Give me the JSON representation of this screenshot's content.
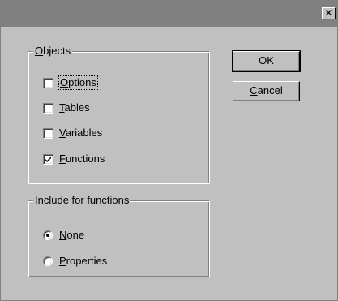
{
  "window": {
    "close_glyph": "✕"
  },
  "objects": {
    "legend": "Objects",
    "legend_mnemonic": "O",
    "legend_rest": "bjects",
    "items": [
      {
        "first": "O",
        "rest": "ptions",
        "checked": false
      },
      {
        "first": "T",
        "rest": "ables",
        "checked": false
      },
      {
        "first": "V",
        "rest": "ariables",
        "checked": false
      },
      {
        "first": "F",
        "rest": "unctions",
        "checked": true
      }
    ]
  },
  "include": {
    "legend": "Include for functions",
    "items": [
      {
        "first": "N",
        "rest": "one",
        "selected": true
      },
      {
        "first": "P",
        "rest": "roperties",
        "selected": false
      }
    ]
  },
  "buttons": {
    "ok": "OK",
    "cancel_first": "C",
    "cancel_rest": "ancel"
  },
  "colors": {
    "face": "#c0c0c0",
    "titlebar": "#808080"
  }
}
